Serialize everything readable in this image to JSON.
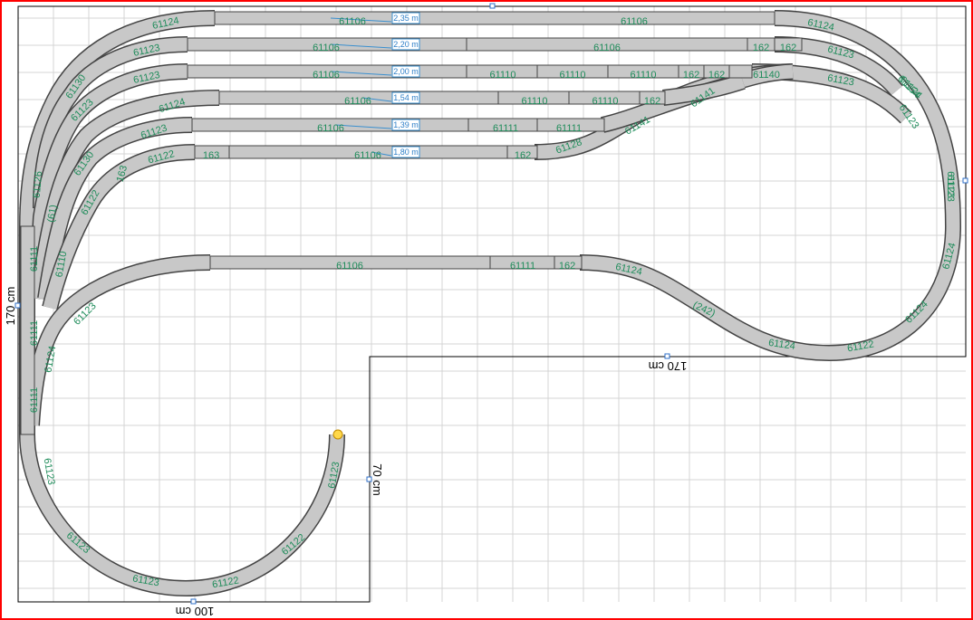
{
  "board": {
    "dimensions": {
      "left": "170 cm",
      "inner_horizontal": "170 cm",
      "inner_vertical": "70 cm",
      "bottom": "100 cm"
    }
  },
  "colors": {
    "frame": "#ff0000",
    "track_fill": "#c8c8c8",
    "track_edge": "#444444",
    "label": "#1e8c5a",
    "length_label": "#2e7fc8"
  },
  "straight_labels": [
    {
      "id": "s1",
      "text": "61106"
    },
    {
      "id": "s2",
      "text": "61106"
    },
    {
      "id": "s3",
      "text": "61106"
    },
    {
      "id": "s4",
      "text": "61106"
    },
    {
      "id": "s5",
      "text": "61106"
    },
    {
      "id": "s6",
      "text": "61106"
    },
    {
      "id": "s7",
      "text": "61106"
    },
    {
      "id": "s8",
      "text": "61106"
    },
    {
      "id": "s9",
      "text": "61110"
    },
    {
      "id": "s10",
      "text": "61110"
    },
    {
      "id": "s11",
      "text": "61110"
    },
    {
      "id": "s12",
      "text": "162"
    },
    {
      "id": "s13",
      "text": "162"
    },
    {
      "id": "s14",
      "text": "162"
    },
    {
      "id": "s15",
      "text": "162"
    },
    {
      "id": "s16",
      "text": "61110"
    },
    {
      "id": "s17",
      "text": "61110"
    },
    {
      "id": "s18",
      "text": "162"
    },
    {
      "id": "s19",
      "text": "61111"
    },
    {
      "id": "s20",
      "text": "61111"
    },
    {
      "id": "s21",
      "text": "163"
    },
    {
      "id": "s22",
      "text": "162"
    },
    {
      "id": "s23",
      "text": "61106"
    },
    {
      "id": "s24",
      "text": "61111"
    },
    {
      "id": "s25",
      "text": "162"
    },
    {
      "id": "s26",
      "text": "61140"
    }
  ],
  "length_labels": [
    {
      "id": "l1",
      "text": "2,35 m"
    },
    {
      "id": "l2",
      "text": "2,20 m"
    },
    {
      "id": "l3",
      "text": "2,00 m"
    },
    {
      "id": "l4",
      "text": "1,54 m"
    },
    {
      "id": "l5",
      "text": "1,39 m"
    },
    {
      "id": "l6",
      "text": "1,80 m"
    }
  ],
  "curve_labels": [
    {
      "id": "c1",
      "text": "61124"
    },
    {
      "id": "c2",
      "text": "61123"
    },
    {
      "id": "c3",
      "text": "61123"
    },
    {
      "id": "c4",
      "text": "61124"
    },
    {
      "id": "c5",
      "text": "61123"
    },
    {
      "id": "c6",
      "text": "61122"
    },
    {
      "id": "c7",
      "text": "163"
    },
    {
      "id": "c8",
      "text": "61124"
    },
    {
      "id": "c9",
      "text": "61123"
    },
    {
      "id": "c10",
      "text": "61123"
    },
    {
      "id": "c11",
      "text": "61124"
    },
    {
      "id": "c12",
      "text": "61123"
    },
    {
      "id": "c13",
      "text": "61123"
    },
    {
      "id": "c14",
      "text": "61122"
    },
    {
      "id": "c15",
      "text": "61122"
    },
    {
      "id": "c16",
      "text": "61124"
    },
    {
      "id": "c17",
      "text": "61122"
    },
    {
      "id": "c18",
      "text": "(242)"
    },
    {
      "id": "c19",
      "text": "61124"
    },
    {
      "id": "c20",
      "text": "61124"
    },
    {
      "id": "c21",
      "text": "61123"
    },
    {
      "id": "c22",
      "text": "61123"
    },
    {
      "id": "c23",
      "text": "61123"
    },
    {
      "id": "c24",
      "text": "61123"
    },
    {
      "id": "c25",
      "text": "61123"
    },
    {
      "id": "c26",
      "text": "61123"
    },
    {
      "id": "c27",
      "text": "61111"
    },
    {
      "id": "c28",
      "text": "61111"
    },
    {
      "id": "c29",
      "text": "61111"
    },
    {
      "id": "c30",
      "text": "61110"
    },
    {
      "id": "c31",
      "text": "61122"
    },
    {
      "id": "c32",
      "text": "(61)"
    },
    {
      "id": "c33",
      "text": "61126"
    },
    {
      "id": "c34",
      "text": "61128"
    },
    {
      "id": "c35",
      "text": "61141"
    },
    {
      "id": "c36",
      "text": "61141"
    },
    {
      "id": "c37",
      "text": "61130"
    },
    {
      "id": "c38",
      "text": "61130"
    },
    {
      "id": "c39",
      "text": "61124"
    },
    {
      "id": "c40",
      "text": "61124"
    },
    {
      "id": "c41",
      "text": "61154"
    },
    {
      "id": "c42",
      "text": "61123"
    },
    {
      "id": "c43",
      "text": "(60)"
    },
    {
      "id": "c44",
      "text": "(60)"
    },
    {
      "id": "c45",
      "text": "61155"
    },
    {
      "id": "c46",
      "text": "61124"
    }
  ]
}
